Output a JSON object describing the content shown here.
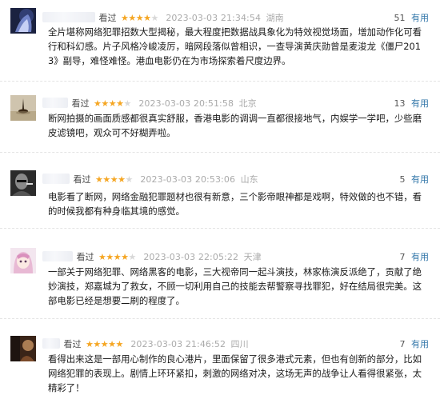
{
  "reviews": [
    {
      "status": "看过",
      "rating": 4,
      "date": "2023-03-03 21:34:54",
      "location": "湖南",
      "votes": "51",
      "useful_label": "有用",
      "avatar_icon": "avatar-icon",
      "content": "全片堪称网络犯罪招数大型揭秘，最大程度把数据战具象化为特效视觉场面，增加动作化可看行和科幻感。片子风格冷峻凌厉，暗网段落似曾相识，一查导演黄庆勋曾是麦浚龙《僵尸2013》副导，难怪难怪。港血电影仍在为市场探索着尺度边界。"
    },
    {
      "status": "看过",
      "rating": 4,
      "date": "2023-03-03 20:51:58",
      "location": "北京",
      "votes": "13",
      "useful_label": "有用",
      "avatar_icon": "avatar-icon",
      "content": "断网拍摄的画面质感都很真实舒服，香港电影的调调一直都很接地气，内娱学一学吧，少些磨皮滤镜吧，观众可不好糊弄啦。"
    },
    {
      "status": "看过",
      "rating": 4,
      "date": "2023-03-03 20:53:06",
      "location": "山东",
      "votes": "5",
      "useful_label": "有用",
      "avatar_icon": "avatar-icon",
      "content": "电影看了断网，网络金融犯罪题材也很有新意，三个影帝眼神都是戏啊，特效做的也不错，看的时候我都有种身临其境的感觉。"
    },
    {
      "status": "看过",
      "rating": 4,
      "date": "2023-03-03 22:05:22",
      "location": "天津",
      "votes": "7",
      "useful_label": "有用",
      "avatar_icon": "avatar-icon",
      "content": "一部关于网络犯罪、网络黑客的电影，三大视帝同一起斗演技，林家栋演反派绝了，贡献了绝妙演技，郑嘉城为了救女，不顾一切利用自己的技能去帮警察寻找罪犯，好在结局很完美。这部电影已经是想要二刷的程度了。"
    },
    {
      "status": "看过",
      "rating": 5,
      "date": "2023-03-03 21:46:52",
      "location": "四川",
      "votes": "7",
      "useful_label": "有用",
      "avatar_icon": "avatar-icon",
      "content": "看得出来这是一部用心制作的良心港片，里面保留了很多港式元素，但也有创新的部分，比如网络犯罪的表现上。剧情上环环紧扣，刺激的网络对决，这场无声的战争让人看得很紧张，太精彩了！"
    }
  ]
}
